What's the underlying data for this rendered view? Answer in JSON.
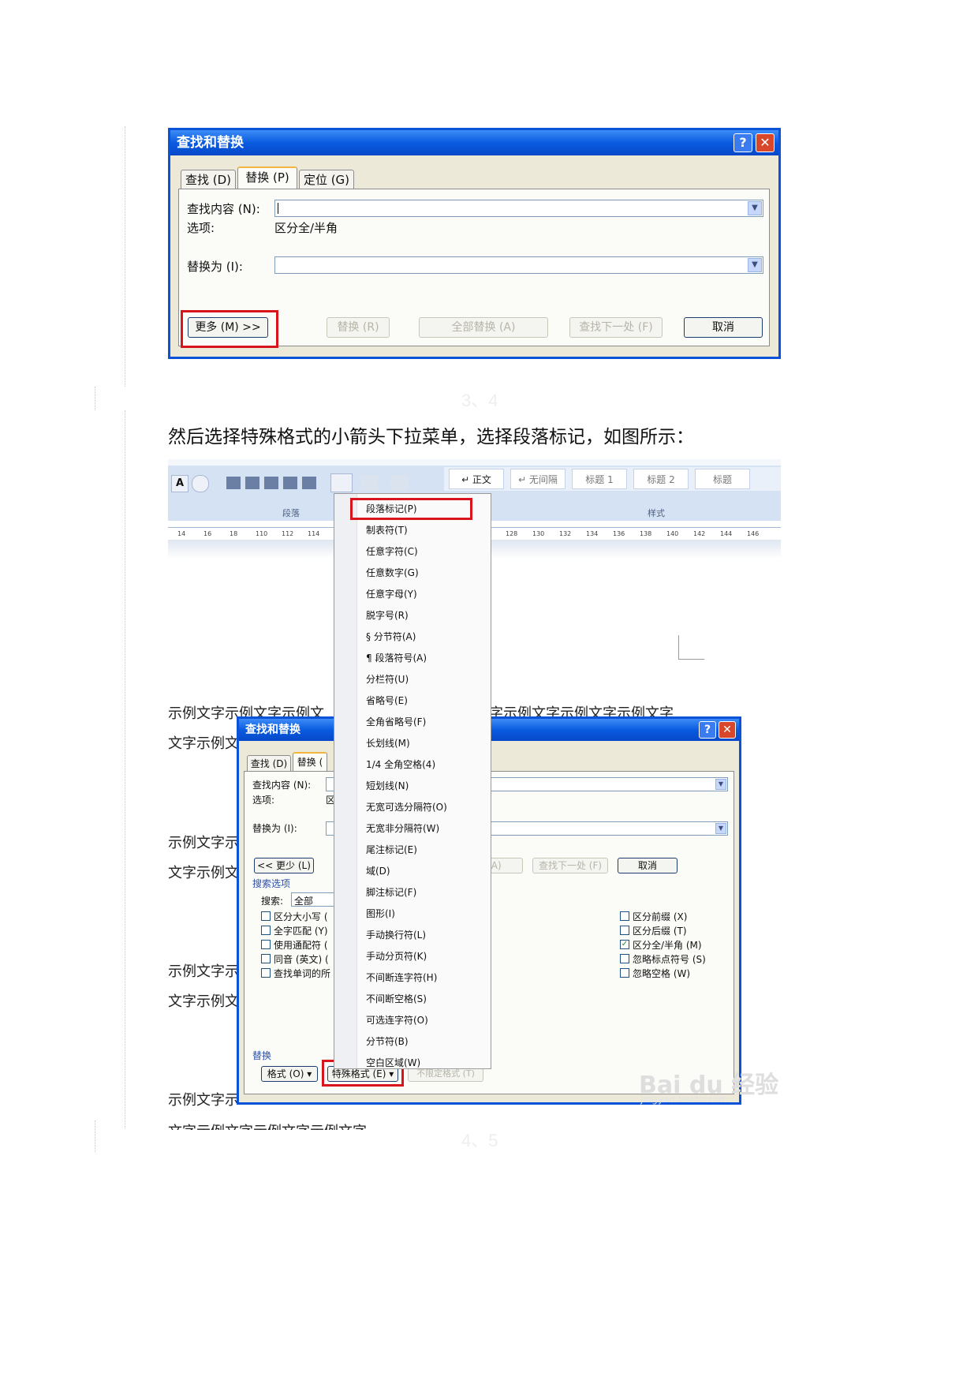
{
  "dialog1": {
    "title": "查找和替换",
    "tabs": [
      "查找 (D)",
      "替换 (P)",
      "定位 (G)"
    ],
    "find_label": "查找内容 (N):",
    "options_label": "选项:",
    "options_value": "区分全/半角",
    "replace_label": "替换为 (I):",
    "buttons": {
      "more": "更多 (M) >>",
      "replace": "替换 (R)",
      "replace_all": "全部替换 (A)",
      "find_next": "查找下一处 (F)",
      "cancel": "取消"
    }
  },
  "instruction": "然后选择特殊格式的小箭头下拉菜单，选择段落标记，如图所示：",
  "faint_step1": "3、4",
  "faint_step2": "4、5",
  "ribbon": {
    "group_paragraph": "段落",
    "group_styles": "样式",
    "styles": [
      "↵ 正文",
      "↵ 无间隔",
      "标题 1",
      "标题 2",
      "标题"
    ],
    "ruler_ticks": [
      "14",
      "16",
      "18",
      "110",
      "112",
      "114",
      "128",
      "130",
      "132",
      "134",
      "136",
      "138",
      "140",
      "142",
      "144",
      "146"
    ]
  },
  "menu_items": [
    "段落标记(P)",
    "制表符(T)",
    "任意字符(C)",
    "任意数字(G)",
    "任意字母(Y)",
    "脱字号(R)",
    "§ 分节符(A)",
    "¶ 段落符号(A)",
    "分栏符(U)",
    "省略号(E)",
    "全角省略号(F)",
    "长划线(M)",
    "1/4 全角空格(4)",
    "短划线(N)",
    "无宽可选分隔符(O)",
    "无宽非分隔符(W)",
    "尾注标记(E)",
    "域(D)",
    "脚注标记(F)",
    "图形(I)",
    "手动换行符(L)",
    "手动分页符(K)",
    "不间断连字符(H)",
    "不间断空格(S)",
    "可选连字符(O)",
    "分节符(B)",
    "空白区域(W)"
  ],
  "doc_lines": [
    "示例文字示例文字示例文",
    "字示例文字示例文字示例文字",
    "文字示例文",
    "示例文字示",
    "文字示例文",
    "示例文字示",
    "文字示例文",
    "示例文字示",
    "文字示例文字示例文字示例文字"
  ],
  "dialog2": {
    "title": "查找和替换",
    "tabs": [
      "查找 (D)",
      "替换 ("
    ],
    "find_label": "查找内容 (N):",
    "options_label": "选项:",
    "options_value": "区",
    "replace_label": "替换为 (I):",
    "less_button": "<< 更少 (L)",
    "replace_all_btn": "替换 (A)",
    "find_next_btn": "查找下一处 (F)",
    "cancel_btn": "取消",
    "search_options": "搜索选项",
    "search_label": "搜索:",
    "search_value": "全部",
    "left_checks": [
      "区分大小写 (",
      "全字匹配 (Y)",
      "使用通配符 (",
      "同音 (英文) (",
      "查找单词的所"
    ],
    "right_checks": [
      {
        "label": "区分前缀 (X)",
        "checked": false
      },
      {
        "label": "区分后缀 (T)",
        "checked": false
      },
      {
        "label": "区分全/半角 (M)",
        "checked": true
      },
      {
        "label": "忽略标点符号 (S)",
        "checked": false
      },
      {
        "label": "忽略空格 (W)",
        "checked": false
      }
    ],
    "replace_section": "替换",
    "format_btn": "格式 (O) ▾",
    "special_btn": "特殊格式 (E) ▾",
    "no_format_btn": "不限定格式 (T)"
  },
  "watermark": "Bai du 经验",
  "watermark_sub": "jingyan.baidu.com"
}
